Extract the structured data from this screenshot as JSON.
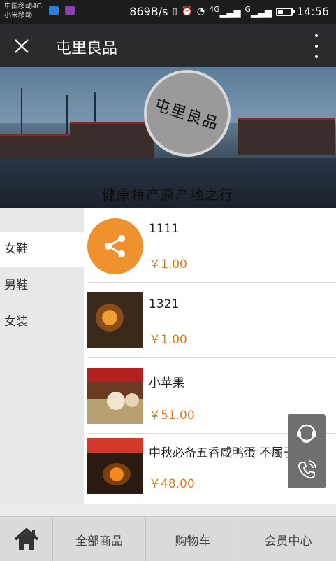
{
  "status_bar": {
    "carrier_top": "中国移动4G",
    "carrier_bottom": "小米移动",
    "net_speed": "869B/s",
    "signal_1": "4G",
    "signal_2": "G",
    "time": "14:56"
  },
  "app_bar": {
    "title": "屯里良品"
  },
  "banner": {
    "logo_text": "屯里良品",
    "slogan": "健康特产原产地之行"
  },
  "categories": [
    {
      "label": "女鞋",
      "active": true
    },
    {
      "label": "男鞋",
      "active": false
    },
    {
      "label": "女装",
      "active": false
    }
  ],
  "products": [
    {
      "name": "1111",
      "price": "￥1.00",
      "image": "share-icon"
    },
    {
      "name": "1321",
      "price": "￥1.00",
      "image": "salted-egg-photo"
    },
    {
      "name": "小苹果",
      "price": "￥51.00",
      "image": "pastry-photo"
    },
    {
      "name": "中秋必备五香咸鸭蛋 不属于大流",
      "price": "￥48.00",
      "image": "duck-egg-photo"
    }
  ],
  "bottom_nav": {
    "home_icon": "home-icon",
    "all_products": "全部商品",
    "cart": "购物车",
    "member_center": "会员中心"
  },
  "colors": {
    "price": "#e87a1c",
    "share_circle": "#f0912f",
    "app_bar": "#2b2b2d"
  }
}
